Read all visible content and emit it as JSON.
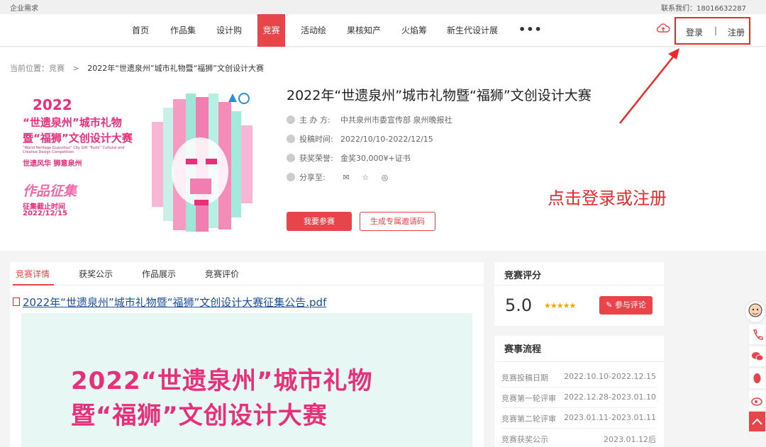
{
  "topbar": {
    "left": "企业需求",
    "right": "联系我们：18016632287"
  },
  "nav": {
    "items": [
      "首页",
      "作品集",
      "设计购",
      "竞赛",
      "活动绘",
      "果核知产",
      "火焰筹",
      "新生代设计展"
    ],
    "active_index": 3,
    "more": "•••",
    "login": "登录",
    "separator": "|",
    "register": "注册"
  },
  "breadcrumb": {
    "prefix": "当前位置：竞赛",
    "arrow": ">",
    "current": "2022年“世遗泉州”城市礼物暨“福狮”文创设计大赛"
  },
  "poster": {
    "year": "2022",
    "line1": "“世遗泉州”城市礼物",
    "line2": "暨“福狮”文创设计大赛",
    "english": "“World Heritage Quanzhou” City Gift “Fushi” Cultural and Creative Design Competition",
    "slogan": "世遗风华  狮意泉州",
    "collect": "作品征集",
    "deadline_label": "征集截止时间",
    "deadline": "2022/12/15"
  },
  "contest": {
    "title": "2022年“世遗泉州”城市礼物暨“福狮”文创设计大赛",
    "organizer_label": "主 办 方:",
    "organizer": "中共泉州市委宣传部 泉州晚报社",
    "time_label": "投稿时间:",
    "time": "2022/10/10-2022/12/15",
    "prize_label": "获奖荣誉:",
    "prize": "金奖30,000¥+证书",
    "share_label": "分享至:",
    "join_button": "我要参赛",
    "invite_button": "生成专属邀请码"
  },
  "annotation": "点击登录或注册",
  "tabs": [
    "竞赛详情",
    "获奖公示",
    "作品展示",
    "竞赛评价"
  ],
  "detail": {
    "pdf_link": "2022年“世遗泉州”城市礼物暨“福狮”文创设计大赛征集公告.pdf",
    "banner_line1": "2022“世遗泉州”城市礼物",
    "banner_line2": "暨“福狮”文创设计大赛"
  },
  "rating": {
    "title": "竞赛评分",
    "score": "5.0",
    "stars": "★★★★★",
    "rate_button": "参与评论",
    "rating_value": 5
  },
  "process": {
    "title": "赛事流程",
    "rows": [
      {
        "label": "竞赛投稿日期",
        "value": "2022.10.10-2022.12.15"
      },
      {
        "label": "竞赛第一轮评审",
        "value": "2022.12.28-2023.01.10"
      },
      {
        "label": "竞赛第二轮评审",
        "value": "2023.01.11-2023.01.11"
      },
      {
        "label": "竞赛获奖公示",
        "value": "2023.01.12后"
      }
    ]
  },
  "colors": {
    "accent": "#e8454a",
    "annotation": "#e82a2a",
    "poster_pink": "#e8307a"
  }
}
